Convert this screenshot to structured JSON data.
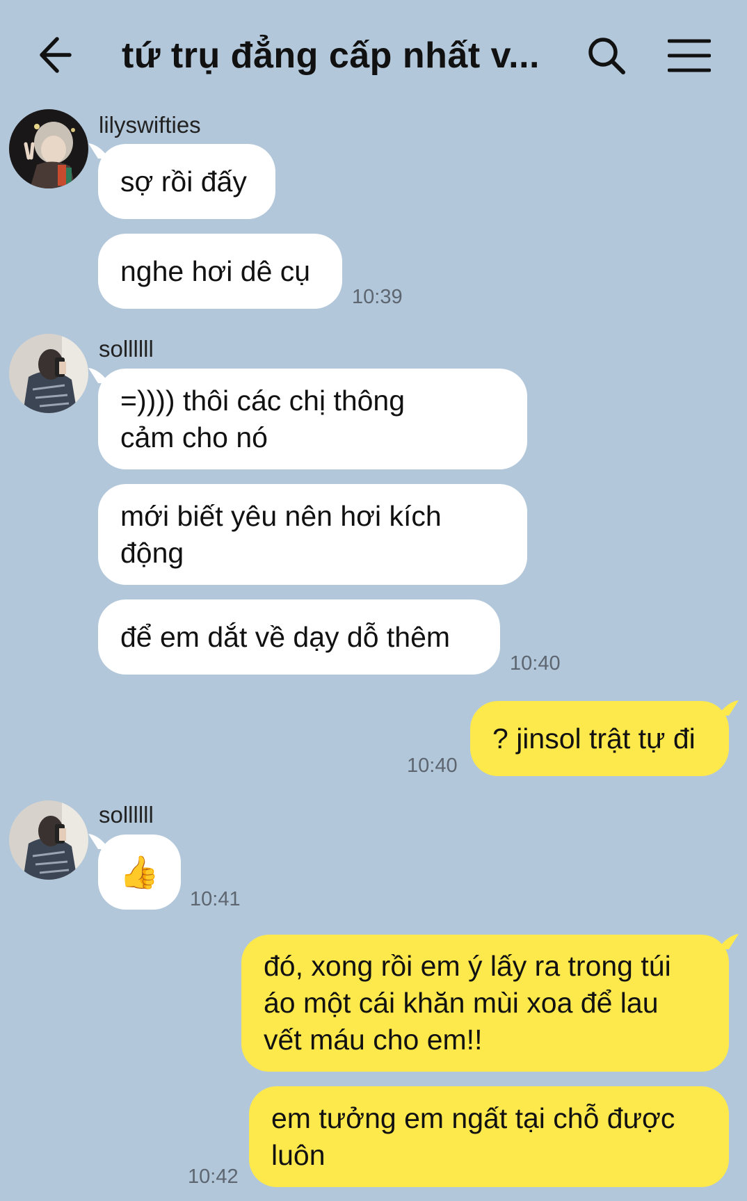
{
  "header": {
    "title": "tứ trụ đẳng cấp nhất v...",
    "back_icon": "arrow-left-icon",
    "search_icon": "search-icon",
    "menu_icon": "menu-icon"
  },
  "messages": [
    {
      "sender": "lilyswifties",
      "texts": [
        "sợ rồi đấy",
        "nghe hơi dê cụ"
      ],
      "time": "10:39"
    },
    {
      "sender": "sollllll",
      "texts": [
        "=)))) thôi các chị thông\ncảm cho nó",
        "mới biết yêu nên hơi kích\nđộng",
        "để em dắt về dạy dỗ thêm"
      ],
      "time": "10:40"
    },
    {
      "sender": "me",
      "texts": [
        "? jinsol trật tự đi"
      ],
      "time": "10:40"
    },
    {
      "sender": "sollllll",
      "texts": [
        "👍"
      ],
      "time": "10:41"
    },
    {
      "sender": "me",
      "texts": [
        "đó, xong rồi em ý lấy ra trong túi\náo một cái khăn mùi xoa để lau\nvết máu cho em!!",
        "em tưởng em ngất tại chỗ được\nluôn"
      ],
      "time": "10:42"
    }
  ],
  "colors": {
    "background": "#b2c7da",
    "incoming_bubble": "#ffffff",
    "outgoing_bubble": "#fee94d"
  }
}
